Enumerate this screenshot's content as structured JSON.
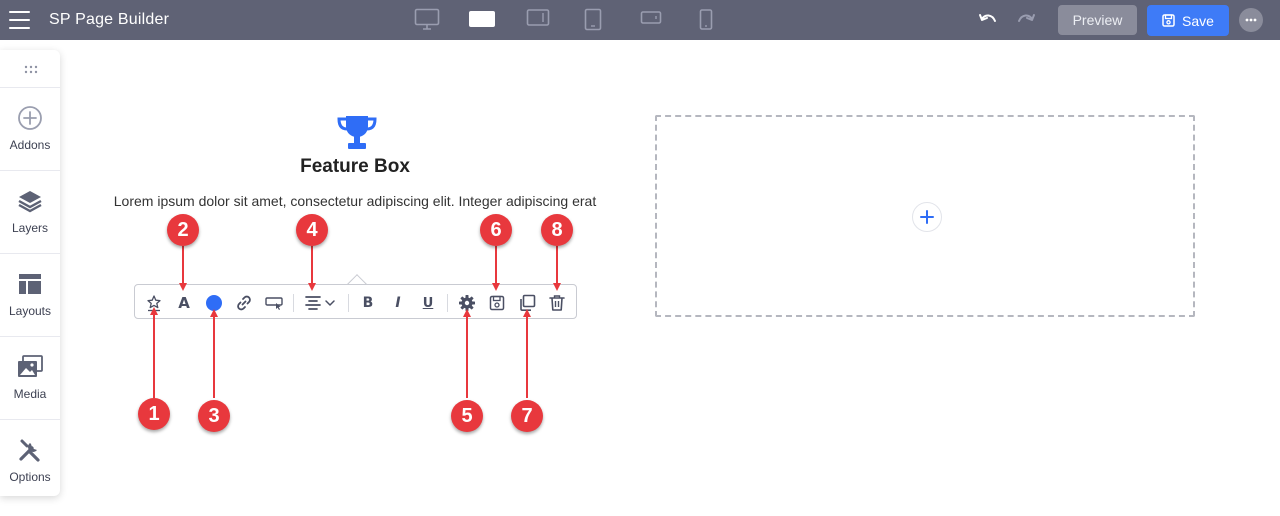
{
  "topbar": {
    "title": "SP Page Builder",
    "devices": [
      "desktop-large-icon",
      "desktop-icon",
      "tablet-landscape-icon",
      "tablet-icon",
      "mobile-landscape-icon",
      "mobile-icon"
    ],
    "preview_label": "Preview",
    "save_label": "Save"
  },
  "sidebar": {
    "items": [
      {
        "label": "Addons",
        "icon": "plus-circle-icon"
      },
      {
        "label": "Layers",
        "icon": "layers-icon"
      },
      {
        "label": "Layouts",
        "icon": "layout-icon"
      },
      {
        "label": "Media",
        "icon": "media-icon"
      },
      {
        "label": "Options",
        "icon": "tools-icon"
      }
    ]
  },
  "feature_box": {
    "title": "Feature Box",
    "text": "Lorem ipsum dolor sit amet, consectetur adipiscing elit. Integer adipiscing erat"
  },
  "toolbar": {
    "font_letter": "A",
    "bold_letter": "B",
    "italic_letter": "I",
    "underline_letter": "U",
    "color_value": "#2f6df6"
  },
  "callouts": [
    "1",
    "2",
    "3",
    "4",
    "5",
    "6",
    "7",
    "8"
  ],
  "colors": {
    "topbar": "#5f6275",
    "accent": "#3e7bf7",
    "callout": "#e8383d"
  }
}
